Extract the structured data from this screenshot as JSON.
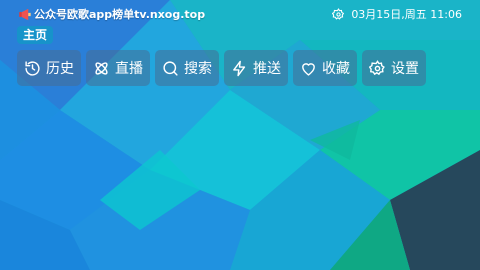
{
  "app": {
    "title": "公众号欧歌app榜单tv.nxog.top",
    "date_time": "03月15日,周五 11:06"
  },
  "tabs": [
    {
      "label": "主页",
      "active": true
    }
  ],
  "menu": [
    {
      "label": "历史",
      "icon": "history-icon"
    },
    {
      "label": "直播",
      "icon": "live-icon"
    },
    {
      "label": "搜索",
      "icon": "search-icon"
    },
    {
      "label": "推送",
      "icon": "push-icon"
    },
    {
      "label": "收藏",
      "icon": "heart-icon"
    },
    {
      "label": "设置",
      "icon": "settings-icon"
    }
  ],
  "colors": {
    "background_primary": "#1a9fd6",
    "background_accent": "#11c4a8",
    "background_dark": "#26485c"
  }
}
